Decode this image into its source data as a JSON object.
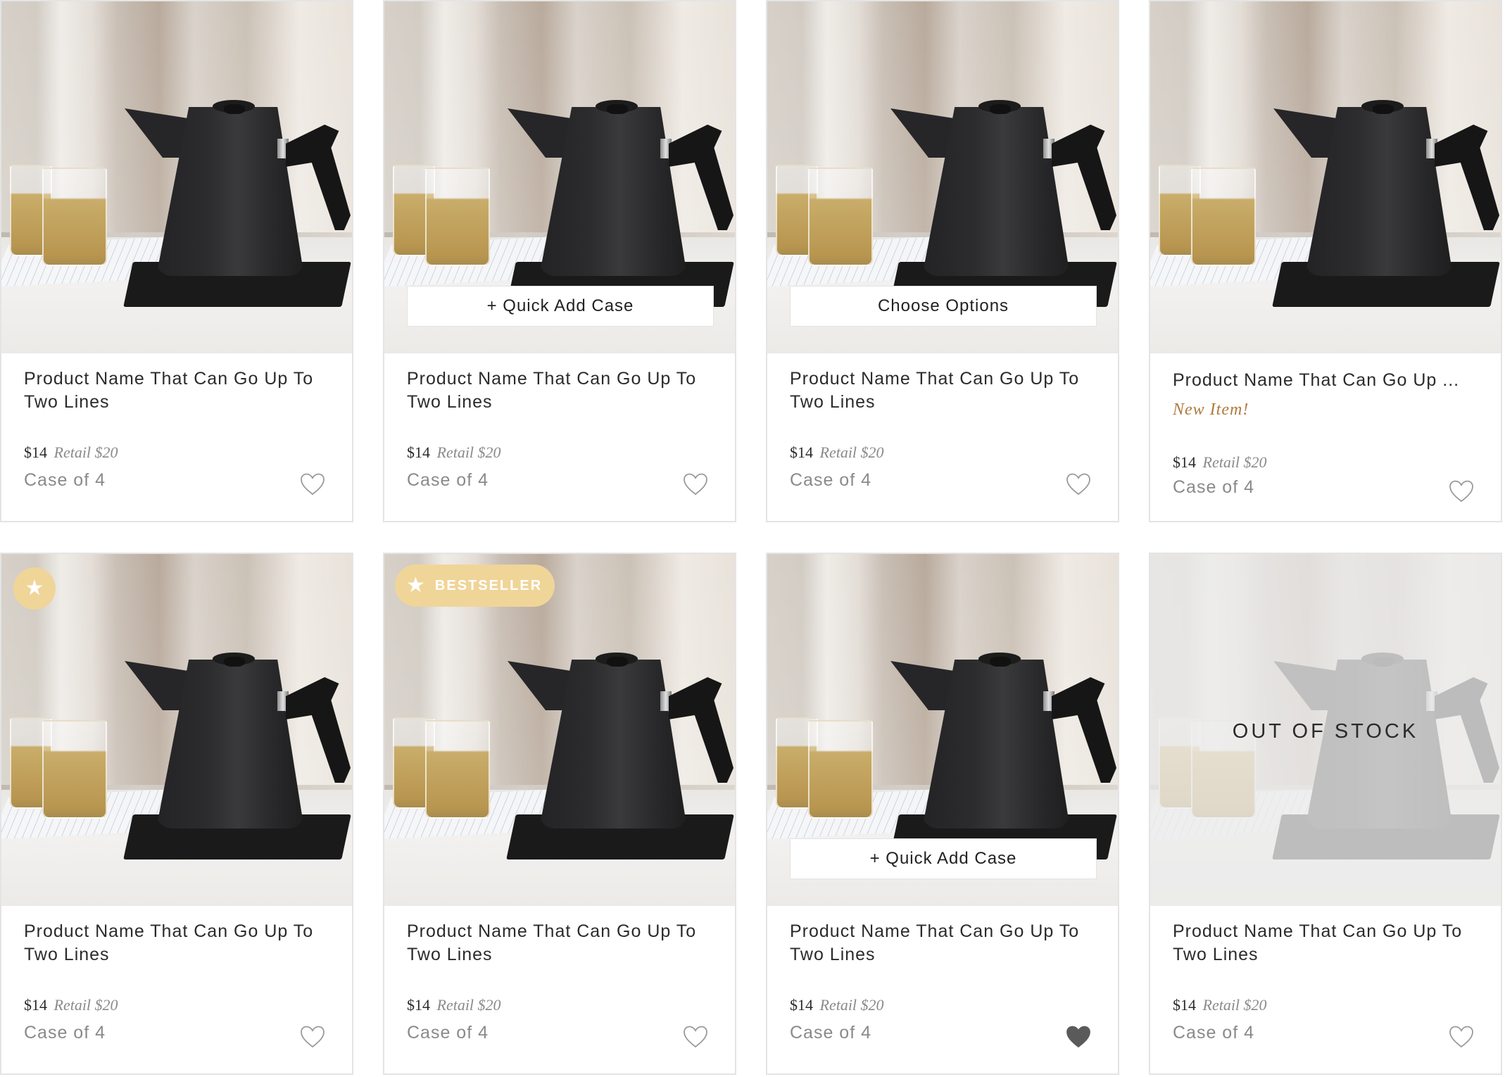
{
  "products": [
    {
      "name": "Product Name That Can Go Up To Two Lines",
      "price": "$14",
      "retail": "Retail $20",
      "case": "Case of 4",
      "overlay_button": "",
      "badge": "",
      "new_label": "",
      "out_of_stock": "",
      "favorited": false
    },
    {
      "name": "Product Name That Can Go Up To Two Lines",
      "price": "$14",
      "retail": "Retail $20",
      "case": "Case of 4",
      "overlay_button": "+ Quick Add Case",
      "badge": "",
      "new_label": "",
      "out_of_stock": "",
      "favorited": false
    },
    {
      "name": "Product Name That Can Go Up To Two Lines",
      "price": "$14",
      "retail": "Retail $20",
      "case": "Case of 4",
      "overlay_button": "Choose Options",
      "badge": "",
      "new_label": "",
      "out_of_stock": "",
      "favorited": false
    },
    {
      "name": "Product Name That Can Go Up ...",
      "price": "$14",
      "retail": "Retail $20",
      "case": "Case of 4",
      "overlay_button": "",
      "badge": "",
      "new_label": "New Item!",
      "out_of_stock": "",
      "favorited": false
    },
    {
      "name": "Product Name That Can Go Up To Two Lines",
      "price": "$14",
      "retail": "Retail $20",
      "case": "Case of 4",
      "overlay_button": "",
      "badge": "star",
      "new_label": "",
      "out_of_stock": "",
      "favorited": false
    },
    {
      "name": "Product Name That Can Go Up To Two Lines",
      "price": "$14",
      "retail": "Retail $20",
      "case": "Case of 4",
      "overlay_button": "",
      "badge": "BESTSELLER",
      "new_label": "",
      "out_of_stock": "",
      "favorited": false
    },
    {
      "name": "Product Name That Can Go Up To Two Lines",
      "price": "$14",
      "retail": "Retail $20",
      "case": "Case of 4",
      "overlay_button": "+ Quick Add Case",
      "badge": "",
      "new_label": "",
      "out_of_stock": "",
      "favorited": true
    },
    {
      "name": "Product Name That Can Go Up To Two Lines",
      "price": "$14",
      "retail": "Retail $20",
      "case": "Case of 4",
      "overlay_button": "",
      "badge": "",
      "new_label": "",
      "out_of_stock": "OUT OF STOCK",
      "favorited": false
    }
  ],
  "colors": {
    "badge_gold": "#f0d599",
    "new_item": "#b07a3d",
    "heart_outline": "#9a9a9a",
    "heart_filled": "#5a5a5a"
  },
  "icons": {
    "favorite": "heart-icon",
    "badge": "star-icon"
  }
}
